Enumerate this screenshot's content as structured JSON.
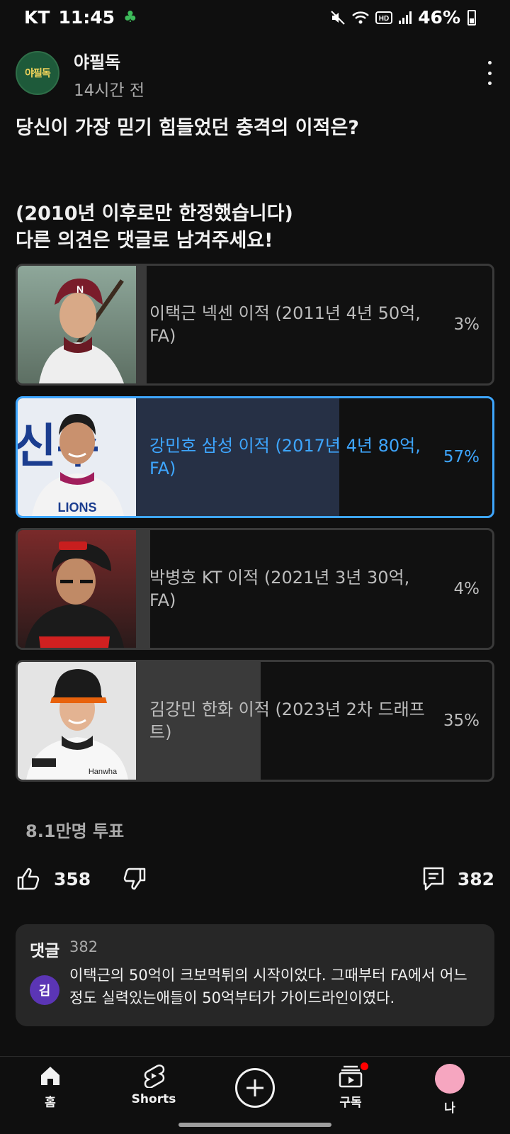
{
  "status_bar": {
    "carrier": "KT",
    "time": "11:45",
    "battery": "46%",
    "battery_level": 0.46
  },
  "post": {
    "channel": "야필독",
    "avatar_text": "야필독",
    "time_ago": "14시간 전",
    "title": "당신이 가장 믿기 힘들었던 충격의 이적은?",
    "note_line1": "(2010년 이후로만 한정했습니다)",
    "note_line2": "다른 의견은 댓글로 남겨주세요!"
  },
  "poll": {
    "options": [
      {
        "text": "이택근 넥센 이적 (2011년 4년 50억, FA)",
        "percent": "3%",
        "value": 3,
        "selected": false
      },
      {
        "text": "강민호 삼성 이적 (2017년 4년 80억, FA)",
        "percent": "57%",
        "value": 57,
        "selected": true
      },
      {
        "text": "박병호 KT 이적 (2021년 3년 30억, FA)",
        "percent": "4%",
        "value": 4,
        "selected": false
      },
      {
        "text": "김강민 한화 이적 (2023년 2차 드래프트)",
        "percent": "35%",
        "value": 35,
        "selected": false
      }
    ],
    "votes": "8.1만명 투표"
  },
  "actions": {
    "likes": "358",
    "comments": "382"
  },
  "comments_preview": {
    "title": "댓글",
    "count": "382",
    "avatar_letter": "김",
    "text": "이택근의 50억이 크보먹튀의 시작이었다. 그때부터 FA에서 어느정도 실력있는애들이 50억부터가 가이드라인이였다."
  },
  "nav": {
    "home": "홈",
    "shorts": "Shorts",
    "subscriptions": "구독",
    "you": "나"
  },
  "colors": {
    "accent": "#3ea6ff",
    "background": "#0f0f0f"
  }
}
